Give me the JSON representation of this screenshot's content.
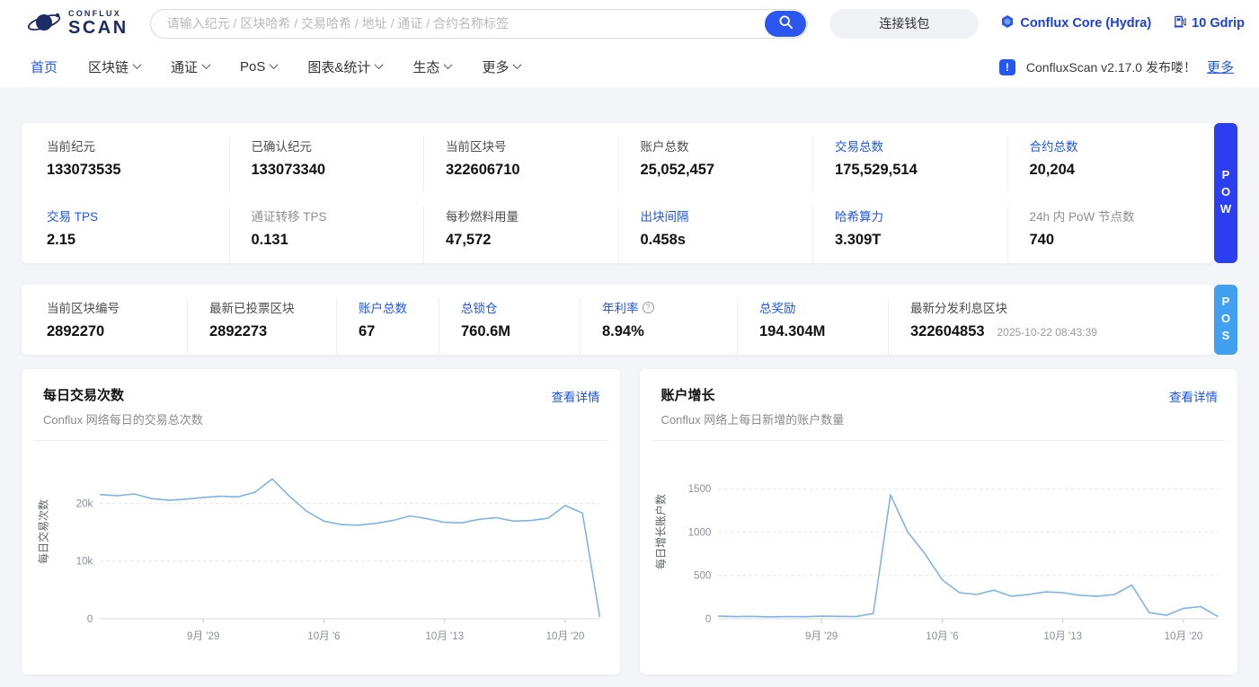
{
  "accent": "#1f55f0",
  "header": {
    "logo_top": "CONFLUX",
    "logo_bottom": "SCAN",
    "search_placeholder": "请输入纪元 / 区块哈希 / 交易哈希 / 地址 / 通证 / 合约名称标签",
    "connect_wallet": "连接钱包",
    "network": "Conflux Core (Hydra)",
    "gas": "10 Gdrip"
  },
  "nav": {
    "items": [
      {
        "label": "首页"
      },
      {
        "label": "区块链"
      },
      {
        "label": "通证"
      },
      {
        "label": "PoS"
      },
      {
        "label": "图表&统计"
      },
      {
        "label": "生态"
      },
      {
        "label": "更多"
      }
    ],
    "announcement": "ConfluxScan v2.17.0 发布喽！",
    "more_link": "更多"
  },
  "pow": {
    "tab": "POW",
    "stats": [
      {
        "label": "当前纪元",
        "value": "133073535",
        "variant": "plain"
      },
      {
        "label": "已确认纪元",
        "value": "133073340",
        "variant": "plain"
      },
      {
        "label": "当前区块号",
        "value": "322606710",
        "variant": "plain"
      },
      {
        "label": "账户总数",
        "value": "25,052,457",
        "variant": "plain"
      },
      {
        "label": "交易总数",
        "value": "175,529,514",
        "variant": "link"
      },
      {
        "label": "合约总数",
        "value": "20,204",
        "variant": "link"
      },
      {
        "label": "交易 TPS",
        "value": "2.15",
        "variant": "link"
      },
      {
        "label": "通证转移 TPS",
        "value": "0.131",
        "variant": "muted"
      },
      {
        "label": "每秒燃料用量",
        "value": "47,572",
        "variant": "plain"
      },
      {
        "label": "出块间隔",
        "value": "0.458s",
        "variant": "link"
      },
      {
        "label": "哈希算力",
        "value": "3.309T",
        "variant": "link"
      },
      {
        "label": "24h 内 PoW 节点数",
        "value": "740",
        "variant": "muted"
      }
    ]
  },
  "pos": {
    "tab": "POS",
    "stats": [
      {
        "label": "当前区块编号",
        "value": "2892270",
        "variant": "plain"
      },
      {
        "label": "最新已投票区块",
        "value": "2892273",
        "variant": "plain"
      },
      {
        "label": "账户总数",
        "value": "67",
        "variant": "link"
      },
      {
        "label": "总锁仓",
        "value": "760.6M",
        "variant": "link"
      },
      {
        "label": "年利率",
        "value": "8.94%",
        "variant": "link"
      },
      {
        "label": "总奖励",
        "value": "194.304M",
        "variant": "link"
      },
      {
        "label": "最新分发利息区块",
        "value": "322604853",
        "variant": "plain",
        "timestamp": "2025-10-22 08:43:39"
      }
    ]
  },
  "chart_data": [
    {
      "type": "line",
      "title": "每日交易次数",
      "subtitle": "Conflux 网络每日的交易总次数",
      "link_label": "查看详情",
      "ylabel": "每日交易次数",
      "line_color": "#7eb3e6",
      "ymax": 30000,
      "yticks": [
        {
          "v": 0,
          "label": "0"
        },
        {
          "v": 10000,
          "label": "10k"
        },
        {
          "v": 20000,
          "label": "20k"
        }
      ],
      "xticks": [
        {
          "frac": 0.2069,
          "label": "9月 '29"
        },
        {
          "frac": 0.4483,
          "label": "10月 '6"
        },
        {
          "frac": 0.6897,
          "label": "10月 '13"
        },
        {
          "frac": 0.931,
          "label": "10月 '20"
        }
      ],
      "values": [
        21500,
        21300,
        21600,
        20800,
        20500,
        20700,
        21000,
        21200,
        21100,
        21900,
        24200,
        21200,
        18600,
        16900,
        16300,
        16200,
        16500,
        17000,
        17800,
        17300,
        16700,
        16600,
        17200,
        17500,
        16900,
        17000,
        17400,
        19600,
        18300,
        300
      ]
    },
    {
      "type": "line",
      "title": "账户增长",
      "subtitle": "Conflux 网络上每日新增的账户数量",
      "link_label": "查看详情",
      "ylabel": "每日增长账户数",
      "line_color": "#7eb3e6",
      "ymax": 2000,
      "yticks": [
        {
          "v": 0,
          "label": "0"
        },
        {
          "v": 500,
          "label": "500"
        },
        {
          "v": 1000,
          "label": "1000"
        },
        {
          "v": 1500,
          "label": "1500"
        }
      ],
      "xticks": [
        {
          "frac": 0.2069,
          "label": "9月 '29"
        },
        {
          "frac": 0.4483,
          "label": "10月 '6"
        },
        {
          "frac": 0.6897,
          "label": "10月 '13"
        },
        {
          "frac": 0.931,
          "label": "10月 '20"
        }
      ],
      "values": [
        30,
        25,
        28,
        22,
        26,
        24,
        30,
        28,
        25,
        60,
        1430,
        1000,
        750,
        450,
        300,
        280,
        330,
        260,
        280,
        310,
        300,
        270,
        260,
        280,
        390,
        70,
        40,
        120,
        140,
        25
      ]
    }
  ]
}
